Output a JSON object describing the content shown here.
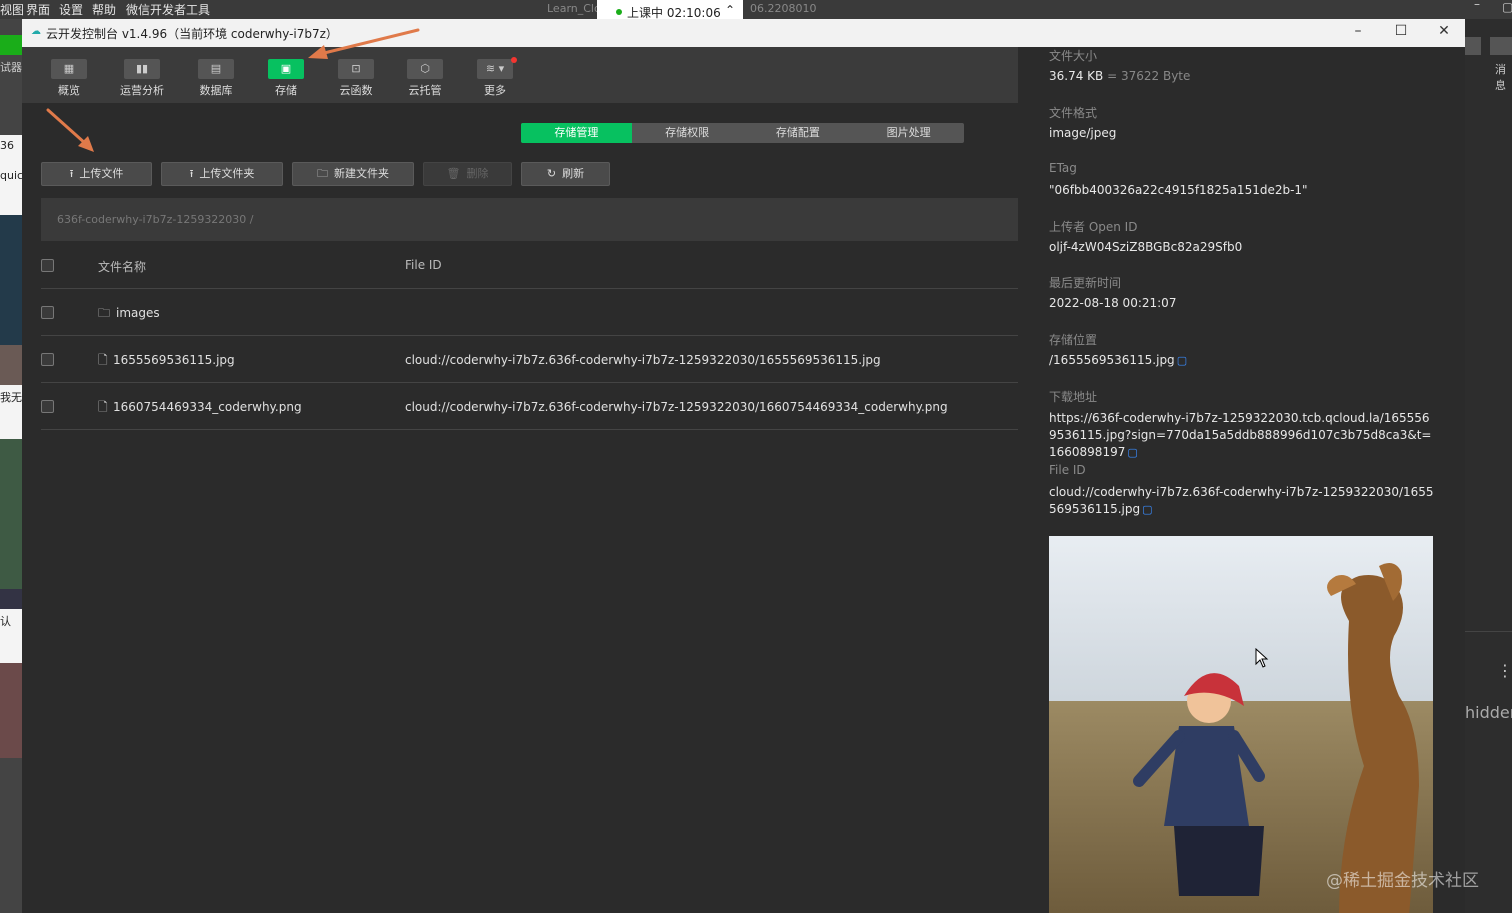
{
  "system_menu": {
    "items": [
      "视图",
      "界面",
      "设置",
      "帮助",
      "微信开发者工具"
    ],
    "bg_text_left": "Learn_Clo",
    "bg_text_right": "06.2208010"
  },
  "timer": {
    "text": "上课中 02:10:06"
  },
  "window": {
    "title": "云开发控制台 v1.4.96（当前环境 coderwhy-i7b7z）"
  },
  "toolbar": {
    "items": [
      {
        "label": "概览",
        "icon": "grid-icon"
      },
      {
        "label": "运营分析",
        "icon": "bar-chart-icon"
      },
      {
        "label": "数据库",
        "icon": "database-icon"
      },
      {
        "label": "存储",
        "icon": "storage-icon"
      },
      {
        "label": "云函数",
        "icon": "function-icon"
      },
      {
        "label": "云托管",
        "icon": "cube-icon"
      },
      {
        "label": "更多",
        "icon": "layers-icon"
      }
    ],
    "active_index": 3
  },
  "tabs": [
    "存储管理",
    "存储权限",
    "存储配置",
    "图片处理"
  ],
  "actions": {
    "upload_file": "上传文件",
    "upload_folder": "上传文件夹",
    "new_folder": "新建文件夹",
    "delete": "删除",
    "refresh": "刷新"
  },
  "breadcrumb": "636f-coderwhy-i7b7z-1259322030 /",
  "table": {
    "columns": {
      "name": "文件名称",
      "file_id": "File ID"
    },
    "rows": [
      {
        "name": "images",
        "type": "folder",
        "file_id": ""
      },
      {
        "name": "1655569536115.jpg",
        "type": "file",
        "file_id": "cloud://coderwhy-i7b7z.636f-coderwhy-i7b7z-1259322030/1655569536115.jpg"
      },
      {
        "name": "1660754469334_coderwhy.png",
        "type": "file",
        "file_id": "cloud://coderwhy-i7b7z.636f-coderwhy-i7b7z-1259322030/1660754469334_coderwhy.png"
      }
    ]
  },
  "detail": {
    "size_label": "文件大小",
    "size_value": "36.74 KB",
    "size_bytes": "= 37622 Byte",
    "format_label": "文件格式",
    "format_value": "image/jpeg",
    "etag_label": "ETag",
    "etag_value": "\"06fbb400326a22c4915f1825a151de2b-1\"",
    "uploader_label": "上传者 Open ID",
    "uploader_value": "oljf-4zW04SziZ8BGBc82a29Sfb0",
    "updated_label": "最后更新时间",
    "updated_value": "2022-08-18 00:21:07",
    "location_label": "存储位置",
    "location_value": "/1655569536115.jpg",
    "download_label": "下载地址",
    "download_value": "https://636f-coderwhy-i7b7z-1259322030.tcb.qcloud.la/1655569536115.jpg?sign=770da15a5ddb888996d107c3b75d8ca3&t=1660898197",
    "fileid_label": "File ID",
    "fileid_value": "cloud://coderwhy-i7b7z.636f-coderwhy-i7b7z-1259322030/1655569536115.jpg"
  },
  "right_strip": {
    "text1": "消息",
    "text2": "hidden"
  },
  "left_strip": {
    "texts": [
      "试器",
      "36",
      "quick",
      "我无",
      "认"
    ]
  },
  "watermark": "@稀土掘金技术社区",
  "colors": {
    "accent": "#07c160",
    "arrow": "#e07a4a",
    "link": "#3a8cff"
  }
}
